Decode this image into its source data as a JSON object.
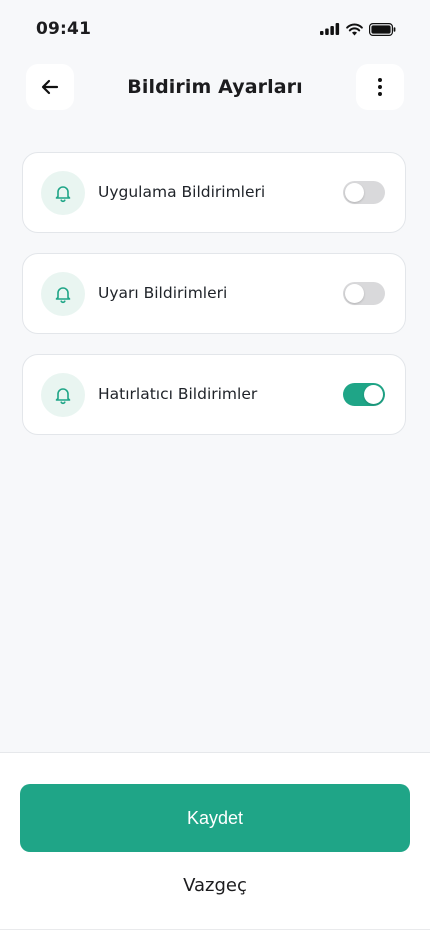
{
  "status_bar": {
    "time": "09:41"
  },
  "header": {
    "title": "Bildirim Ayarları"
  },
  "settings": [
    {
      "label": "Uygulama Bildirimleri",
      "enabled": false
    },
    {
      "label": "Uyarı Bildirimleri",
      "enabled": false
    },
    {
      "label": "Hatırlatıcı Bildirimler",
      "enabled": true
    }
  ],
  "footer": {
    "save_label": "Kaydet",
    "cancel_label": "Vazgeç"
  },
  "colors": {
    "accent": "#1fa587",
    "icon_bg": "#e9f5f1",
    "toggle_off": "#d9d9db"
  }
}
